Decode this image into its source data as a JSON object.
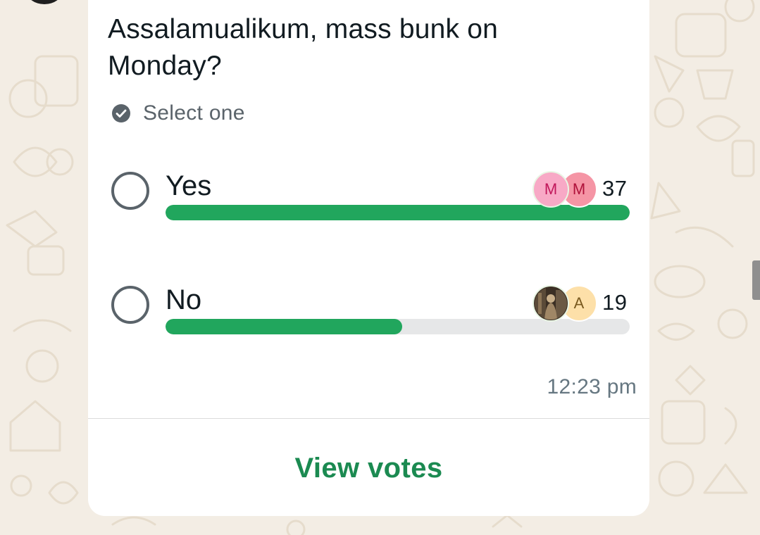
{
  "poll": {
    "question": "Assalamualikum,  mass bunk on Monday?",
    "select_hint": "Select one",
    "options": [
      {
        "label": "Yes",
        "votes": "37",
        "progress_percent": 100,
        "voters": [
          {
            "initial": "M",
            "bg": "#f8a9c6",
            "fg": "#c1185b"
          },
          {
            "initial": "M",
            "bg": "#f595a5",
            "fg": "#b0123a"
          }
        ]
      },
      {
        "label": "No",
        "votes": "19",
        "progress_percent": 51,
        "voters": [
          {
            "initial": "",
            "bg": "#3b2f24",
            "fg": "#ffffff",
            "is_photo": true
          },
          {
            "initial": "A",
            "bg": "#fde0a9",
            "fg": "#7a5a1f"
          }
        ]
      }
    ],
    "timestamp": "12:23 pm",
    "view_votes_label": "View votes"
  },
  "colors": {
    "accent_green": "#21a65d",
    "link_green": "#1b8a51",
    "wallpaper": "#f3ede4",
    "bubble": "#ffffff"
  }
}
